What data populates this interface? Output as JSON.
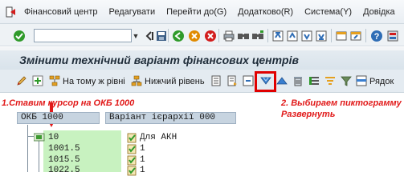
{
  "menu": {
    "items": [
      "Фінансовий центр",
      "Редагувати",
      "Перейти до(G)",
      "Додатково(R)",
      "Система(Y)",
      "Довідка"
    ]
  },
  "toolbar": {
    "command_value": ""
  },
  "title": "Змінити технічний варіант фінансових центрів",
  "app_toolbar": {
    "same_level_label": "На тому ж рівні",
    "lower_level_label": "Нижчий рівень",
    "row_label": "Рядок"
  },
  "annotations": {
    "step1": "1.Ставим курсор на ОКБ 1000",
    "step2_line1": "2. Выбираем пиктограмму",
    "step2_line2": "Развернуть"
  },
  "tree": {
    "root_code": "ОКБ 1000",
    "root_description": "Варіант ієрархії 000",
    "children": [
      {
        "code": "10",
        "description": "Для АКН"
      },
      {
        "code": "1001.5",
        "description": "1"
      },
      {
        "code": "1015.5",
        "description": "1"
      },
      {
        "code": "1022.5",
        "description": "1"
      }
    ]
  },
  "colors": {
    "highlight_red": "#e00000",
    "annotation_red": "#e11919",
    "tree_green": "#c8f2c0",
    "root_node_blue": "#c7d4e0"
  }
}
